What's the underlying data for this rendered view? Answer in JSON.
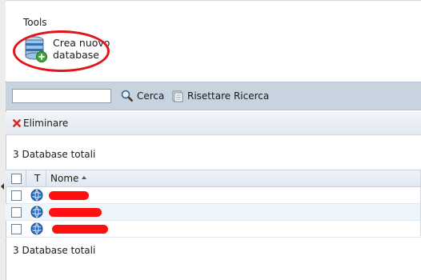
{
  "tools": {
    "title": "Tools",
    "create_db_label": "Crea nuovo database"
  },
  "search": {
    "input_value": "",
    "input_placeholder": "",
    "search_label": "Cerca",
    "reset_label": "Risettare Ricerca"
  },
  "actions": {
    "delete_label": "Eliminare"
  },
  "summary": {
    "top_count": "3 Database totali",
    "bottom_count": "3 Database totali"
  },
  "grid": {
    "headers": {
      "type": "T",
      "name": "Nome"
    },
    "rows": [
      {
        "name_redacted": true,
        "checked": false
      },
      {
        "name_redacted": true,
        "checked": false
      },
      {
        "name_redacted": true,
        "checked": false
      }
    ]
  },
  "colors": {
    "highlight_ring": "#e0141b",
    "toolbar_bg": "#c8d3e0",
    "alt_row_bg": "#eef6fc",
    "redaction": "#ff1010"
  },
  "icons": [
    "database-add-icon",
    "search-icon",
    "reset-search-icon",
    "delete-icon",
    "globe-icon",
    "sort-ascending-icon",
    "collapse-arrow-icon"
  ]
}
